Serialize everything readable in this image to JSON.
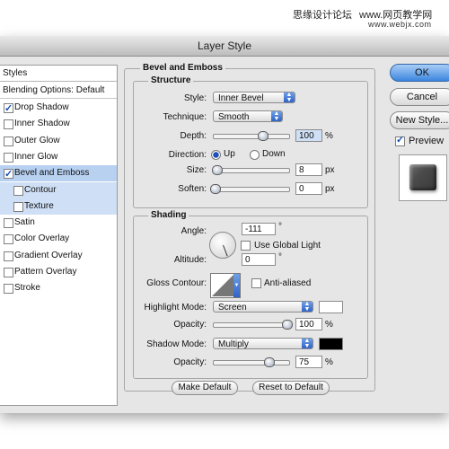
{
  "watermark": {
    "text1": "思缘设计论坛",
    "text2": "www.网页教学网",
    "text3": "www.webjx.com"
  },
  "window": {
    "title": "Layer Style"
  },
  "sidebar": {
    "header": "Styles",
    "blending_options": "Blending Options: Default",
    "items": [
      {
        "label": "Drop Shadow",
        "checked": true
      },
      {
        "label": "Inner Shadow",
        "checked": false
      },
      {
        "label": "Outer Glow",
        "checked": false
      },
      {
        "label": "Inner Glow",
        "checked": false
      },
      {
        "label": "Bevel and Emboss",
        "checked": true
      },
      {
        "label": "Contour",
        "checked": false
      },
      {
        "label": "Texture",
        "checked": false
      },
      {
        "label": "Satin",
        "checked": false
      },
      {
        "label": "Color Overlay",
        "checked": false
      },
      {
        "label": "Gradient Overlay",
        "checked": false
      },
      {
        "label": "Pattern Overlay",
        "checked": false
      },
      {
        "label": "Stroke",
        "checked": false
      }
    ]
  },
  "bevel": {
    "title": "Bevel and Emboss",
    "structure": {
      "title": "Structure",
      "style_label": "Style:",
      "style_value": "Inner Bevel",
      "technique_label": "Technique:",
      "technique_value": "Smooth",
      "depth_label": "Depth:",
      "depth_value": "100",
      "depth_unit": "%",
      "depth_fraction": 0.66,
      "direction_label": "Direction:",
      "up_label": "Up",
      "down_label": "Down",
      "direction_selected": "Up",
      "size_label": "Size:",
      "size_value": "8",
      "size_unit": "px",
      "size_fraction": 0.03,
      "soften_label": "Soften:",
      "soften_value": "0",
      "soften_unit": "px",
      "soften_fraction": 0.0
    },
    "shading": {
      "title": "Shading",
      "angle_label": "Angle:",
      "angle_value": "-111",
      "angle_unit": "°",
      "global_light_label": "Use Global Light",
      "global_light_checked": false,
      "altitude_label": "Altitude:",
      "altitude_value": "0",
      "altitude_unit": "°",
      "gloss_contour_label": "Gloss Contour:",
      "anti_aliased_label": "Anti-aliased",
      "anti_aliased_checked": false,
      "highlight_mode_label": "Highlight Mode:",
      "highlight_mode_value": "Screen",
      "highlight_color": "#ffffff",
      "highlight_opacity_label": "Opacity:",
      "highlight_opacity_value": "100",
      "highlight_opacity_unit": "%",
      "highlight_opacity_fraction": 1.0,
      "shadow_mode_label": "Shadow Mode:",
      "shadow_mode_value": "Multiply",
      "shadow_color": "#000000",
      "shadow_opacity_label": "Opacity:",
      "shadow_opacity_value": "75",
      "shadow_opacity_unit": "%",
      "shadow_opacity_fraction": 0.75
    },
    "make_default_label": "Make Default",
    "reset_default_label": "Reset to Default"
  },
  "actions": {
    "ok_label": "OK",
    "cancel_label": "Cancel",
    "new_style_label": "New Style...",
    "preview_label": "Preview",
    "preview_checked": true
  },
  "colors": {
    "accent": "#3c86df",
    "selection": "#b8d1f1"
  }
}
